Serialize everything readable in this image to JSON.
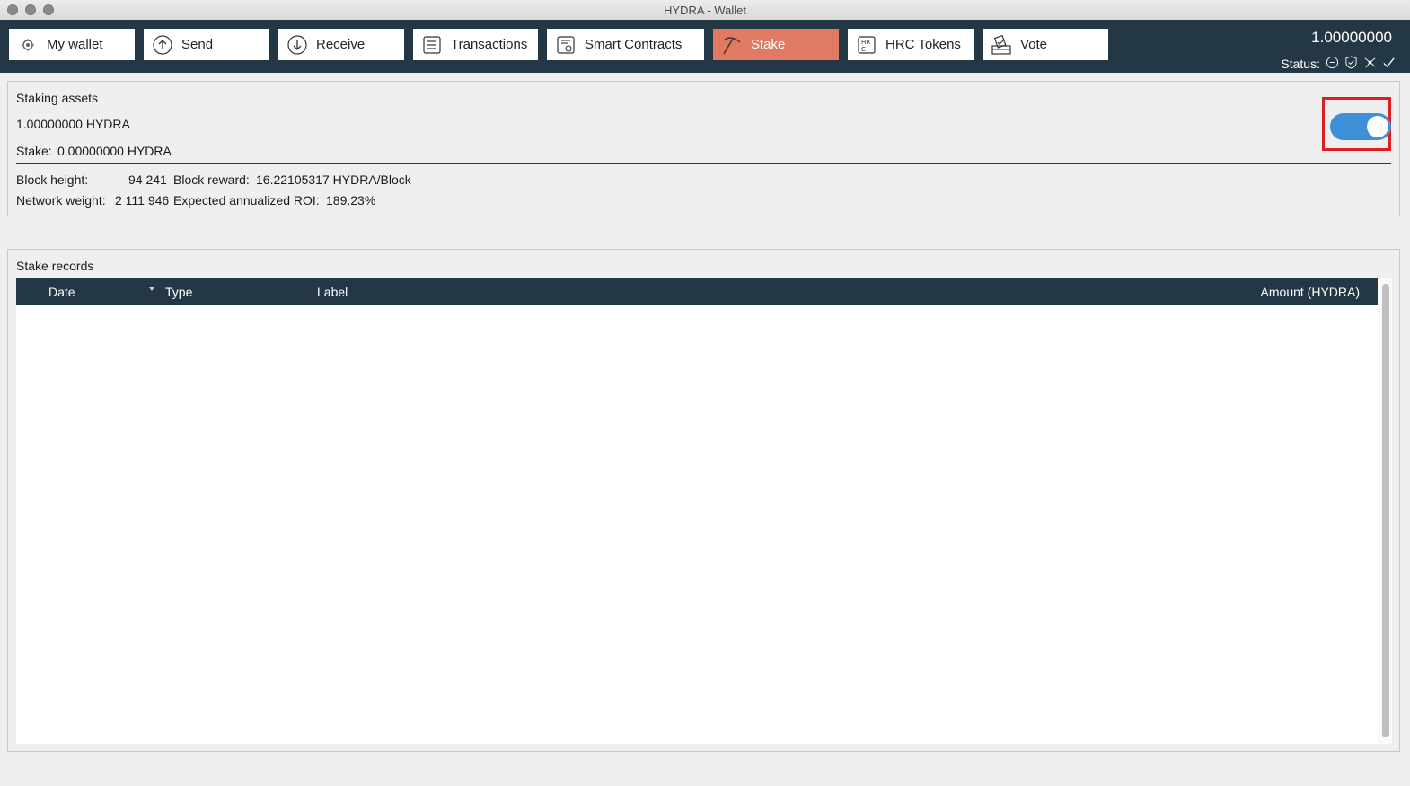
{
  "window": {
    "title": "HYDRA - Wallet"
  },
  "toolbar": {
    "tabs": [
      {
        "label": "My wallet",
        "icon": "wallet-icon"
      },
      {
        "label": "Send",
        "icon": "send-arrow-icon"
      },
      {
        "label": "Receive",
        "icon": "receive-arrow-icon"
      },
      {
        "label": "Transactions",
        "icon": "list-icon"
      },
      {
        "label": "Smart Contracts",
        "icon": "contract-icon"
      },
      {
        "label": "Stake",
        "icon": "pickaxe-icon",
        "active": true
      },
      {
        "label": "HRC Tokens",
        "icon": "hrc-token-icon"
      },
      {
        "label": "Vote",
        "icon": "ballot-icon"
      }
    ],
    "balance": "1.00000000",
    "status_label": "Status:",
    "status_icons": [
      "sync-icon",
      "shield-icon",
      "network-icon",
      "checkmark-icon"
    ]
  },
  "staking": {
    "title": "Staking assets",
    "assets_value": "1.00000000 HYDRA",
    "stake_label": "Stake:",
    "stake_value": "0.00000000 HYDRA",
    "block_height_label": "Block height:",
    "block_height_value": "94 241",
    "block_reward_label": "Block reward:",
    "block_reward_value": "16.22105317 HYDRA/Block",
    "network_weight_label": "Network weight:",
    "network_weight_value": "2 111 946",
    "roi_label": "Expected annualized ROI:",
    "roi_value": "189.23%",
    "toggle_on": true,
    "toggle_color": "#3d8fd8",
    "highlight_color": "#e02020"
  },
  "records": {
    "title": "Stake records",
    "columns": [
      "Date",
      "Type",
      "Label",
      "Amount (HYDRA)"
    ],
    "rows": []
  },
  "colors": {
    "header_bg": "#243744",
    "active_tab": "#e07a62"
  }
}
